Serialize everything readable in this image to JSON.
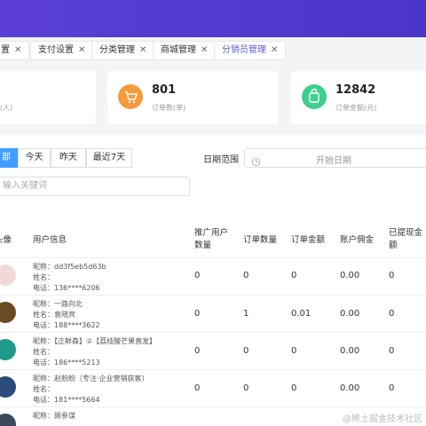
{
  "tabs": [
    {
      "label": "置",
      "active": false
    },
    {
      "label": "支付设置",
      "active": false
    },
    {
      "label": "分类管理",
      "active": false
    },
    {
      "label": "商城管理",
      "active": false
    },
    {
      "label": "分销员管理",
      "active": true
    }
  ],
  "tab_close": "✕",
  "stats": [
    {
      "value": "",
      "label": "(人)"
    },
    {
      "value": "801",
      "label": "订单数(单)",
      "icon": "cart-icon",
      "color": "#f59a3c"
    },
    {
      "value": "12842",
      "label": "订单金额(元)",
      "icon": "bag-icon",
      "color": "#3ecf8e"
    }
  ],
  "filters": {
    "periods": [
      "部",
      "今天",
      "昨天",
      "最近7天"
    ],
    "date_label": "日期范围",
    "date_placeholder": "开始日期",
    "search_placeholder": "输入关键词"
  },
  "table": {
    "headers": {
      "avatar": "头像",
      "user": "用户信息",
      "promoted": "推广用户数量",
      "order_count": "订单数量",
      "order_amount": "订单金额",
      "commission": "账户佣金",
      "withdrawn": "已提现金额"
    },
    "field_labels": {
      "nickname": "昵称：",
      "name": "姓名：",
      "phone": "电话："
    },
    "rows": [
      {
        "nickname": "dd3f5eb5d63b",
        "name": "",
        "phone": "136****6206",
        "promoted": "0",
        "order_count": "0",
        "order_amount": "0",
        "commission": "0.00",
        "withdrawn": "0",
        "avatar_color": "#f1d9d9"
      },
      {
        "nickname": "一路向北",
        "name": "袁晓宾",
        "phone": "188****3622",
        "promoted": "0",
        "order_count": "1",
        "order_amount": "0.01",
        "commission": "0.00",
        "withdrawn": "0",
        "avatar_color": "#6b4b22"
      },
      {
        "nickname": "【正鲜森】②【荔枝酸芒果直发】",
        "name": "",
        "phone": "186****5213",
        "promoted": "0",
        "order_count": "0",
        "order_amount": "0",
        "commission": "0.00",
        "withdrawn": "0",
        "avatar_color": "#1f9a8a"
      },
      {
        "nickname": "赵盼盼（专注·企业营销获客）",
        "name": "",
        "phone": "181****5664",
        "promoted": "0",
        "order_count": "0",
        "order_amount": "0",
        "commission": "0.00",
        "withdrawn": "0",
        "avatar_color": "#2a4b7c"
      },
      {
        "nickname": "顾参谋",
        "name": "",
        "phone": "",
        "promoted": "",
        "order_count": "",
        "order_amount": "",
        "commission": "",
        "withdrawn": "",
        "avatar_color": "#3a4a5a"
      }
    ]
  },
  "watermark": "@稀土掘金技术社区"
}
